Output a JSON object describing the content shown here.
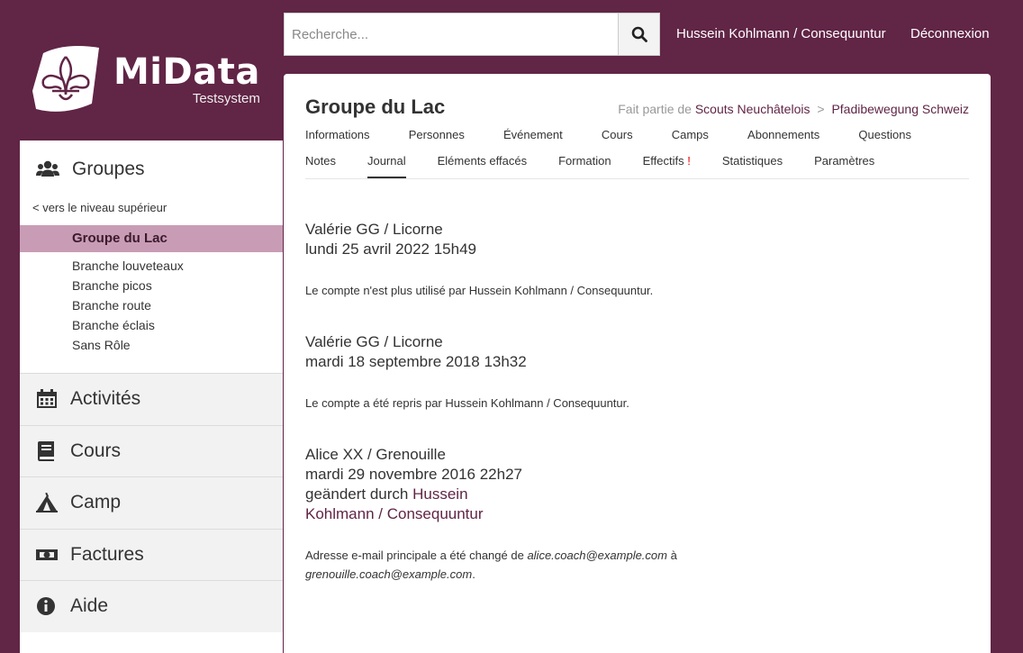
{
  "app": {
    "name": "MiData",
    "subtitle": "Testsystem"
  },
  "header": {
    "search_placeholder": "Recherche...",
    "user": "Hussein Kohlmann / Consequuntur",
    "logout": "Déconnexion"
  },
  "sidebar": {
    "groups_label": "Groupes",
    "up_link": "< vers le niveau supérieur",
    "active_group": "Groupe du Lac",
    "subgroups": [
      "Branche louveteaux",
      "Branche picos",
      "Branche route",
      "Branche éclais",
      "Sans Rôle"
    ],
    "sections": [
      {
        "label": "Activités",
        "icon": "calendar-icon"
      },
      {
        "label": "Cours",
        "icon": "book-icon"
      },
      {
        "label": "Camp",
        "icon": "tent-icon"
      },
      {
        "label": "Factures",
        "icon": "money-bill-icon"
      },
      {
        "label": "Aide",
        "icon": "info-circle-icon"
      }
    ]
  },
  "main": {
    "title": "Groupe du Lac",
    "breadcrumb_prefix": "Fait partie de",
    "breadcrumb": [
      "Scouts Neuchâtelois",
      "Pfadibewegung Schweiz"
    ],
    "breadcrumb_sep": ">",
    "tabs_row1": [
      "Informations",
      "Personnes",
      "Événement",
      "Cours",
      "Camps",
      "Abonnements",
      "Questions"
    ],
    "tabs_row2": [
      "Notes",
      "Journal",
      "Eléments effacés",
      "Formation",
      "Effectifs",
      "Statistiques",
      "Paramètres"
    ],
    "active_tab": "Journal",
    "warning_mark": "!",
    "entries": [
      {
        "author": "Valérie GG / Licorne",
        "date": "lundi 25 avril 2022 15h49",
        "message": "Le compte n'est plus utilisé par Hussein Kohlmann / Consequuntur."
      },
      {
        "author": "Valérie GG / Licorne",
        "date": "mardi 18 septembre 2018 13h32",
        "message": "Le compte a été repris par Hussein Kohlmann / Consequuntur."
      },
      {
        "author": "Alice XX / Grenouille",
        "date": "mardi 29 novembre 2016 22h27",
        "changed_prefix": "geändert durch",
        "changed_by_line1": "Hussein",
        "changed_by_line2": "Kohlmann / Consequuntur",
        "message_prefix": "Adresse e-mail principale a été changé de",
        "old_value": "alice.coach@example.com",
        "connector": "à",
        "new_value": "grenouille.coach@example.com",
        "message_suffix": "."
      }
    ]
  },
  "colors": {
    "brand": "#612546",
    "active_bg": "#c99cb5",
    "warning": "#e00000"
  }
}
